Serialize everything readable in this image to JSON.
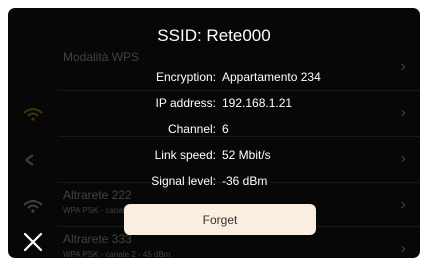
{
  "background_list": [
    {
      "name": "Modalità WPS",
      "sub": "",
      "icon": "wps-icon"
    },
    {
      "name": "",
      "sub": "",
      "icon": "wifi-lock-icon"
    },
    {
      "name": "",
      "sub": "",
      "icon": "wifi-lock-icon"
    },
    {
      "name": "Altrarete 222",
      "sub": "WPA PSK - canale 6",
      "icon": "wifi-icon"
    },
    {
      "name": "Altrarete 333",
      "sub": "WPA PSK - canale 2 - 45 dBm",
      "icon": "wifi-icon"
    }
  ],
  "dialog": {
    "title": "SSID: Rete000",
    "rows": [
      {
        "label": "Encryption:",
        "value": "Appartamento 234"
      },
      {
        "label": "IP address:",
        "value": "192.168.1.21"
      },
      {
        "label": "Channel:",
        "value": "6"
      },
      {
        "label": "Link speed:",
        "value": "52 Mbit/s"
      },
      {
        "label": "Signal level:",
        "value": "-36 dBm"
      }
    ],
    "forget_label": "Forget"
  },
  "icons": {
    "close": "close-icon",
    "chevron": "chevron-right-icon"
  },
  "colors": {
    "screen_bg": "#070707",
    "button_bg": "#faeee0",
    "text": "#ffffff"
  }
}
